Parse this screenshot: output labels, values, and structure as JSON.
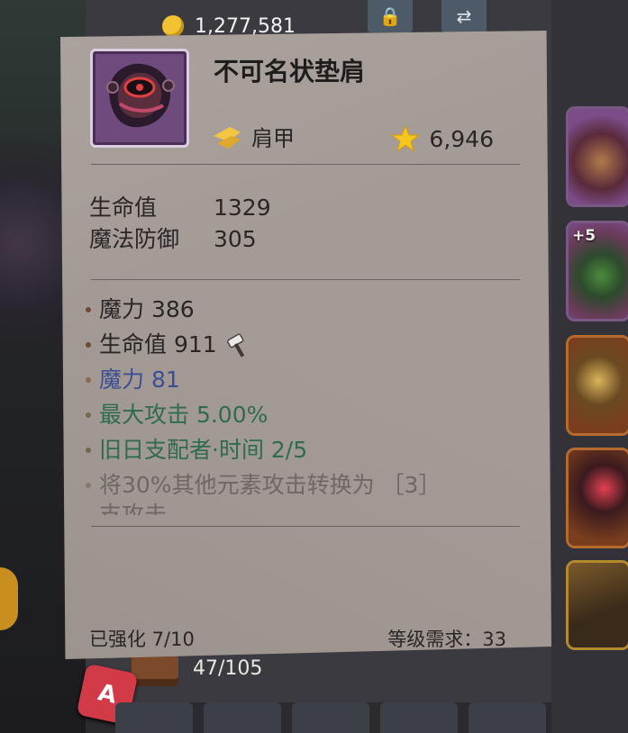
{
  "background": {
    "gold": "1,277,581",
    "inventory_count": "47/105",
    "slots": [
      {
        "plus": ""
      },
      {
        "plus": "+5"
      },
      {
        "plus": ""
      },
      {
        "plus": ""
      },
      {
        "plus": ""
      }
    ],
    "emblem_letter": "A"
  },
  "tooltip": {
    "item_name": "不可名状垫肩",
    "item_type": "肩甲",
    "power": "6,946",
    "base_stats": [
      {
        "label": "生命值",
        "value": "1329"
      },
      {
        "label": "魔法防御",
        "value": "305"
      }
    ],
    "affixes": [
      {
        "text": "魔力 386",
        "color": "#2a2626"
      },
      {
        "text": "生命值 911",
        "color": "#2a2626",
        "icon": "hammer-icon"
      },
      {
        "text": "魔力 81",
        "color": "#3c4f95"
      },
      {
        "text": "最大攻击 5.00%",
        "color": "#2f6b4e"
      },
      {
        "text": "旧日支配者·时间 2/5",
        "color": "#2f6b4e"
      },
      {
        "text": "将30%其他元素攻击转换为 ［3］",
        "color": "#6e6764"
      }
    ],
    "affix_overflow": "支攻击",
    "enhance": "已强化 7/10",
    "level_req": "等级需求：33"
  },
  "colors": {
    "card": "#a49b96",
    "text_dark": "#2a2626",
    "text_blue": "#3c4f95",
    "text_green": "#2f6b4e",
    "text_gray": "#6e6764",
    "icon_frame": "#6f4a7c"
  }
}
